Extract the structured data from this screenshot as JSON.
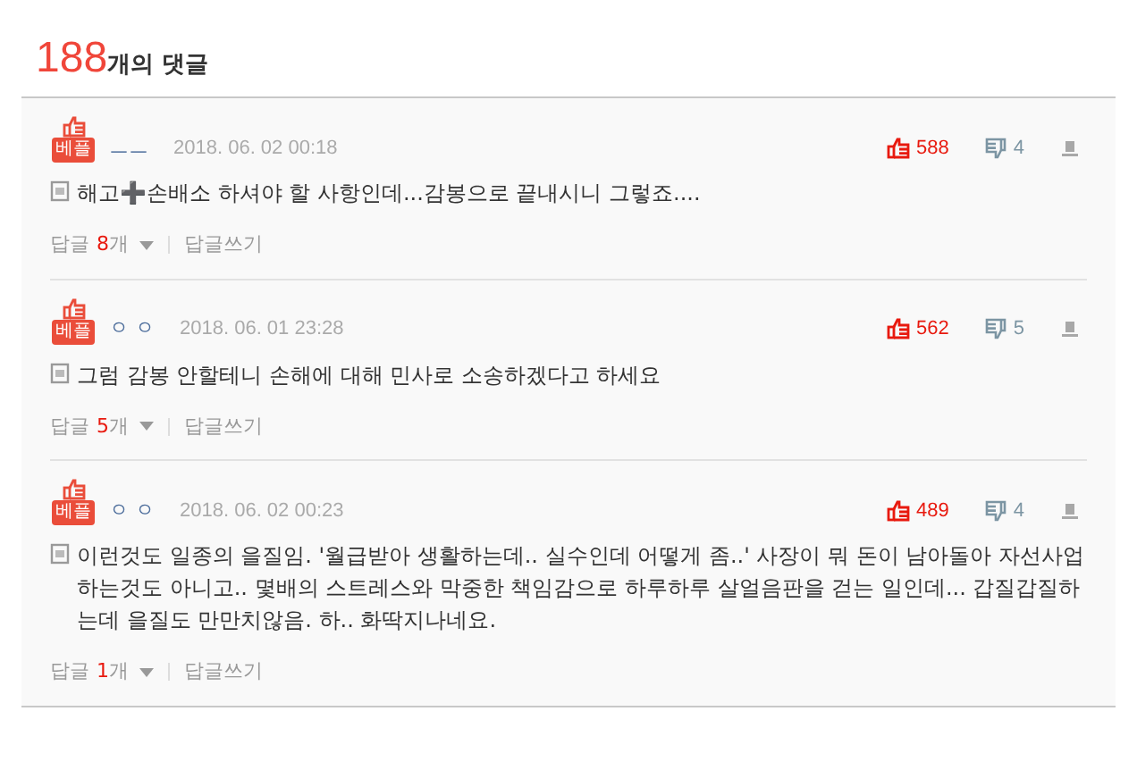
{
  "header": {
    "count": "188",
    "label": "개의 댓글"
  },
  "comments": [
    {
      "badge": "베플",
      "author": "ㅡㅡ",
      "date": "2018. 06. 02 00:18",
      "likes": "588",
      "dislikes": "4",
      "text": "해고➕손배소 하셔야 할 사항인데...감봉으로 끝내시니 그렇죠....",
      "reply_label": "답글",
      "reply_count": "8",
      "reply_unit": "개",
      "write_reply": "답글쓰기"
    },
    {
      "badge": "베플",
      "author": "ㅇ ㅇ",
      "date": "2018. 06. 01 23:28",
      "likes": "562",
      "dislikes": "5",
      "text": "그럼 감봉 안할테니 손해에 대해 민사로 소송하겠다고 하세요",
      "reply_label": "답글",
      "reply_count": "5",
      "reply_unit": "개",
      "write_reply": "답글쓰기"
    },
    {
      "badge": "베플",
      "author": "ㅇ ㅇ",
      "date": "2018. 06. 02 00:23",
      "likes": "489",
      "dislikes": "4",
      "text": "이런것도 일종의 을질임. '월급받아 생활하는데.. 실수인데 어떻게 좀..' 사장이 뭐 돈이 남아돌아 자선사업하는것도 아니고.. 몇배의 스트레스와 막중한 책임감으로 하루하루 살얼음판을 걷는 일인데... 갑질갑질하는데 을질도 만만치않음. 하.. 화딱지나네요.",
      "reply_label": "답글",
      "reply_count": "1",
      "reply_unit": "개",
      "write_reply": "답글쓰기"
    }
  ]
}
